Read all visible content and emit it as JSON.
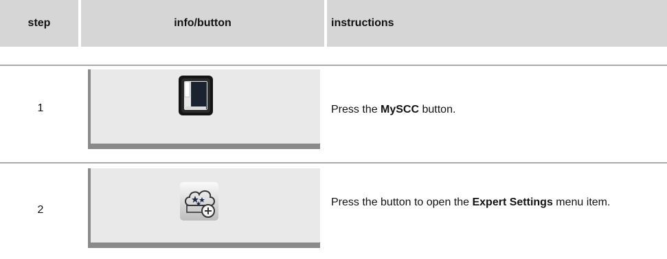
{
  "header": {
    "step": "step",
    "info": "info/button",
    "instructions": "instructions"
  },
  "rows": [
    {
      "step": "1",
      "icon": "myscc-oven-icon",
      "instruction": {
        "before": "Press the ",
        "bold": "MySCC",
        "after": " button."
      }
    },
    {
      "step": "2",
      "icon": "expert-settings-icon",
      "instruction": {
        "before": "Press the button to open the ",
        "bold": "Expert Settings",
        "after": " menu item."
      }
    }
  ]
}
